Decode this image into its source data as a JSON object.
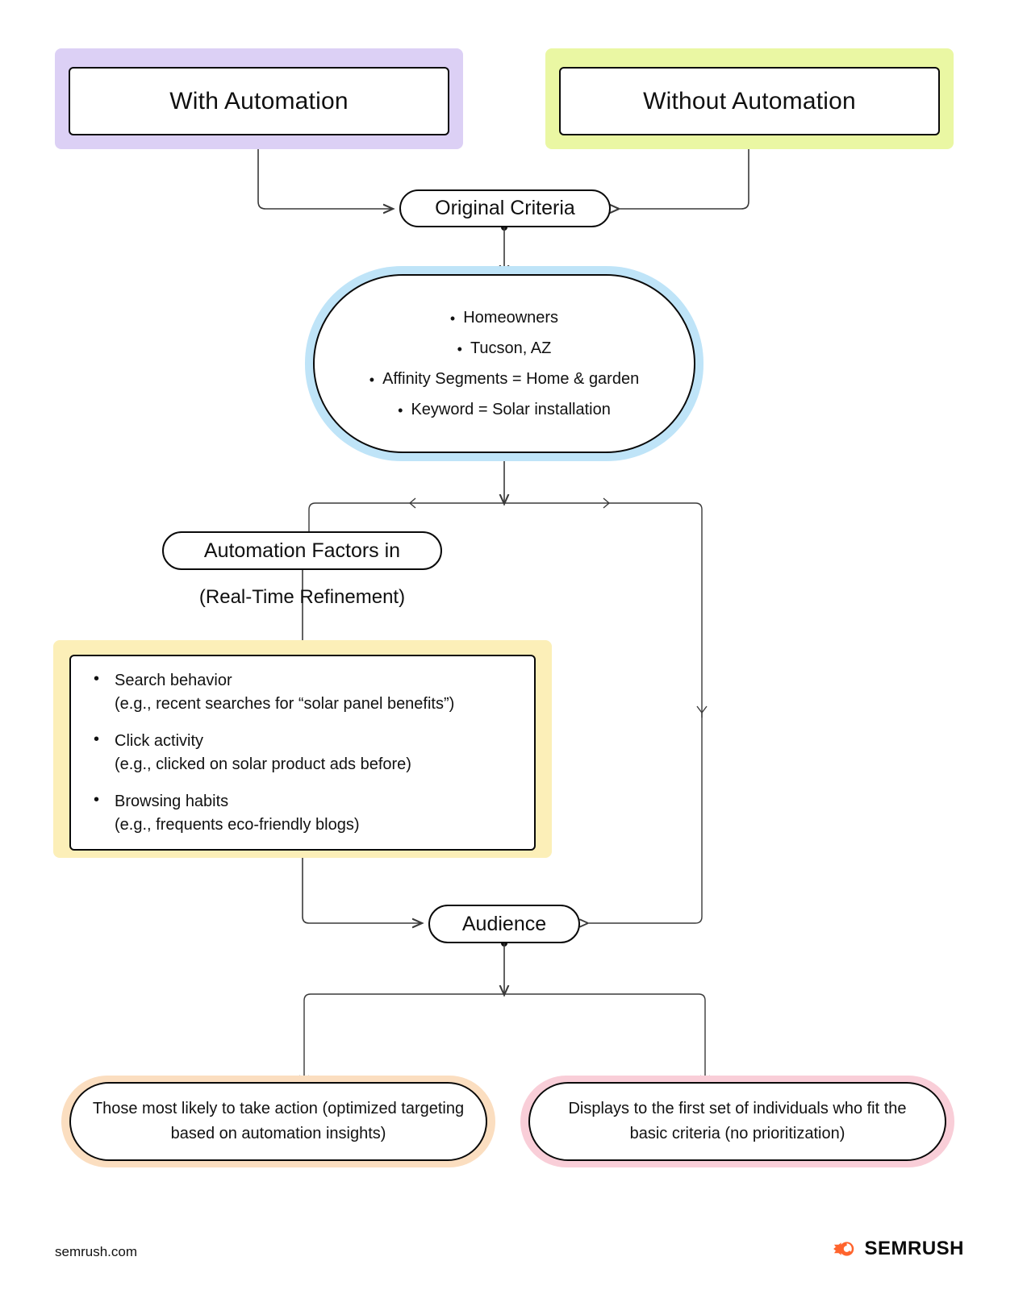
{
  "diagram": {
    "title": "With Automation vs Without Automation targeting flow",
    "colors": {
      "purple_halo": "#dcd0f5",
      "green_halo": "#eaf7a3",
      "blue_halo": "#bfe4f8",
      "yellow_halo": "#fcefb8",
      "orange_halo": "#fbdec0",
      "pink_halo": "#f9ced8",
      "node_border": "#0a0a0a",
      "connector": "#3a3a3a",
      "brand_orange": "#ff642d"
    },
    "nodes": {
      "with_automation": "With Automation",
      "without_automation": "Without Automation",
      "original_criteria": "Original Criteria",
      "criteria_bullets": [
        "Homeowners",
        "Tucson, AZ",
        "Affinity Segments = Home & garden",
        "Keyword = Solar installation"
      ],
      "automation_factors": "Automation Factors in",
      "automation_factors_caption": "(Real-Time Refinement)",
      "factor_items": [
        {
          "main": "Search behavior",
          "sub": "(e.g., recent searches for “solar panel benefits”)"
        },
        {
          "main": "Click activity",
          "sub": "(e.g., clicked on solar product ads before)"
        },
        {
          "main": "Browsing habits",
          "sub": "(e.g., frequents eco-friendly blogs)"
        }
      ],
      "audience": "Audience",
      "result_with_automation": "Those most likely to take action (optimized targeting based on automation insights)",
      "result_without_automation": "Displays to the first set of individuals who fit the basic criteria (no prioritization)"
    }
  },
  "footer": {
    "url": "semrush.com",
    "brand": "SEMRUSH"
  }
}
